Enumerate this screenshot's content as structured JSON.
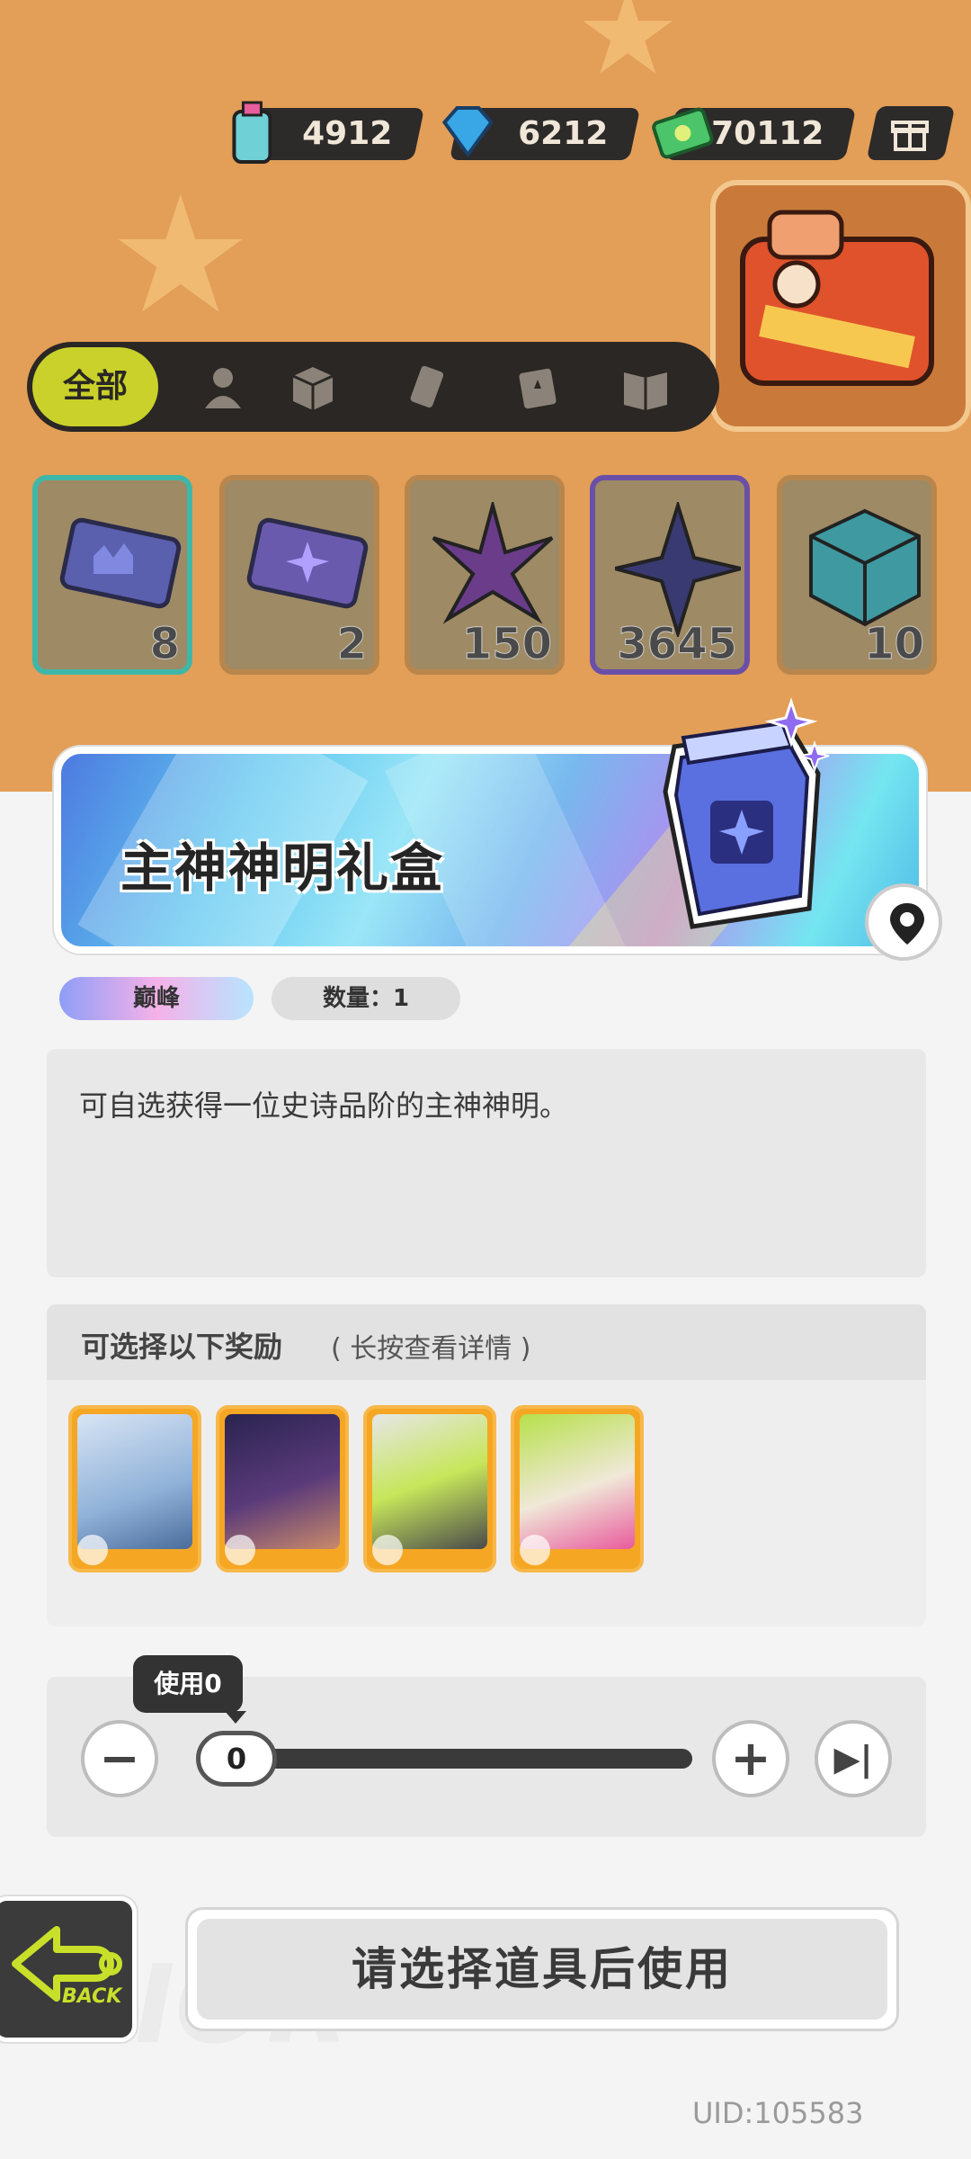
{
  "currencies": [
    {
      "icon": "spray-can-icon",
      "value": "4912"
    },
    {
      "icon": "diamond-icon",
      "value": "6212"
    },
    {
      "icon": "cash-icon",
      "value": "70112"
    }
  ],
  "filter": {
    "all_label": "全部",
    "icons": [
      "person-icon",
      "box-icon",
      "ticket-icon",
      "card-icon",
      "book-icon"
    ]
  },
  "inventory": [
    {
      "icon": "ticket-crown-icon",
      "count": "8"
    },
    {
      "icon": "ticket-star-icon",
      "count": "2"
    },
    {
      "icon": "leaf-star-icon",
      "count": "150"
    },
    {
      "icon": "crystal-star-icon",
      "count": "3645"
    },
    {
      "icon": "cube-icon",
      "count": "10"
    }
  ],
  "item": {
    "title": "主神神明礼盒",
    "rarity": "巅峰",
    "quantity": "数量：1",
    "description": "可自选获得一位史诗品阶的主神神明。"
  },
  "rewards": {
    "title": "可选择以下奖励",
    "hint": "( 长按查看详情 )",
    "count": 4
  },
  "usage": {
    "tooltip": "使用0",
    "value": "0",
    "minus": "−",
    "plus": "+",
    "max": "▶|"
  },
  "actions": {
    "back_label": "BACK",
    "primary_label": "请选择道具后使用"
  },
  "uid": "UID:105583",
  "colors": {
    "accent_yellow": "#c9d12a",
    "reward_orange": "#f5a623",
    "background_orange": "#e39e57"
  }
}
